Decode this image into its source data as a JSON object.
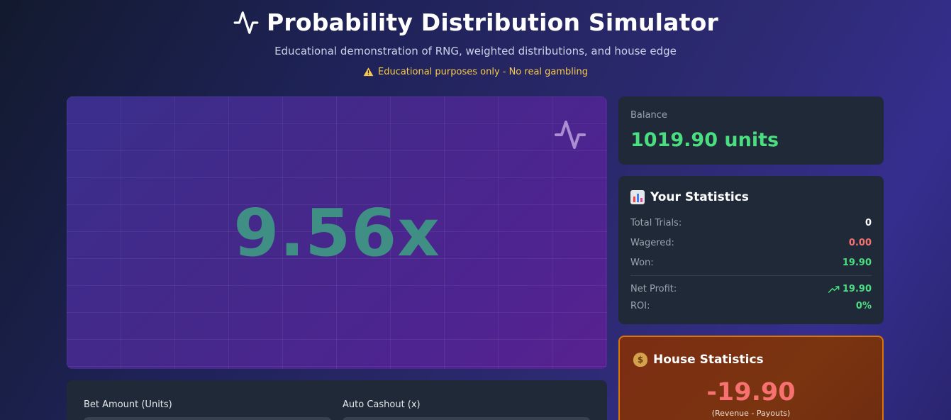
{
  "header": {
    "title": "Probability Distribution Simulator",
    "subtitle": "Educational demonstration of RNG, weighted distributions, and house edge",
    "warning": "Educational purposes only - No real gambling"
  },
  "game": {
    "multiplier": "9.56x",
    "multiplier_color": "#3f8f85"
  },
  "controls": {
    "bet_amount_label": "Bet Amount (Units)",
    "auto_cashout_label": "Auto Cashout (x)"
  },
  "balance": {
    "label": "Balance",
    "value": "1019.90 units"
  },
  "your_statistics": {
    "heading": "Your Statistics",
    "rows": [
      {
        "label": "Total Trials:",
        "value": "0",
        "color": "#ffffff"
      },
      {
        "label": "Wagered:",
        "value": "0.00",
        "color": "#f87171"
      },
      {
        "label": "Won:",
        "value": "19.90",
        "color": "#4ade80"
      },
      {
        "label": "Net Profit:",
        "value": "19.90",
        "color": "#4ade80"
      },
      {
        "label": "ROI:",
        "value": "0%",
        "color": "#4ade80"
      }
    ]
  },
  "house_statistics": {
    "heading": "House Statistics",
    "value": "-19.90",
    "note": "(Revenue - Payouts)"
  },
  "colors": {
    "accent_green": "#4ade80",
    "accent_red": "#f87171",
    "warning_yellow": "#f6c94a",
    "house_border": "#d97706"
  }
}
